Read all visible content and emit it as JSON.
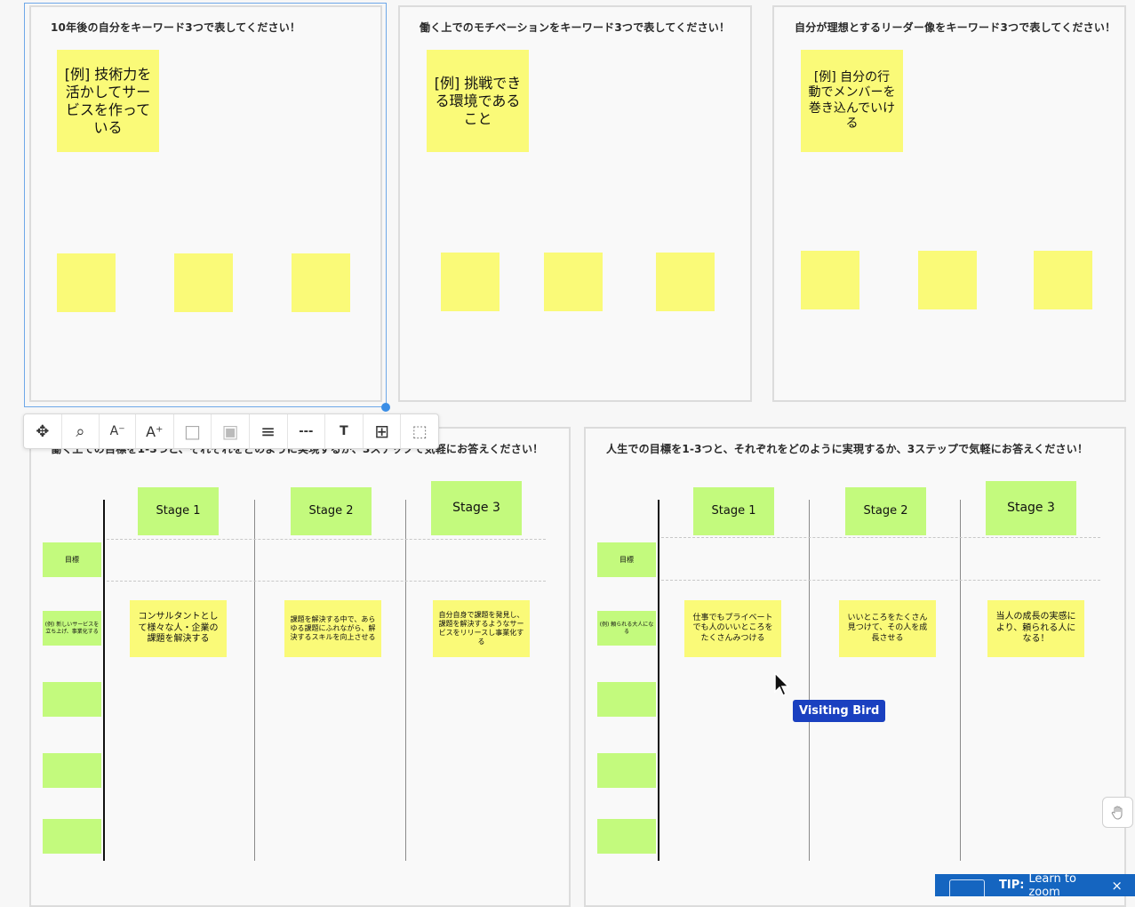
{
  "frames": {
    "f1": {
      "title": "10年後の自分をキーワード3つで表してください！",
      "example": "[例] 技術力を活かしてサービスを作っている"
    },
    "f2": {
      "title": "働く上でのモチベーションをキーワード3つで表してください！",
      "example": "[例] 挑戦できる環境であること"
    },
    "f3": {
      "title": "自分が理想とするリーダー像をキーワード3つで表してください！",
      "example": "[例] 自分の行動でメンバーを巻き込んでいける"
    },
    "f4": {
      "title": "働く上での目標を1-3つと、それぞれをどのように実現するか、3ステップで気軽にお答えください！",
      "stages": [
        "Stage 1",
        "Stage 2",
        "Stage 3"
      ],
      "goal_label": "目標",
      "example_label": "(例) 新しいサービスを立ち上げ、事業化する",
      "steps": [
        "コンサルタントとして様々な人・企業の課題を解決する",
        "課題を解決する中で、あらゆる課題にふれながら、解決するスキルを向上させる",
        "自分自身で課題を発見し、課題を解決するようなサービスをリリースし事業化する"
      ]
    },
    "f5": {
      "title": "人生での目標を1-3つと、それぞれをどのように実現するか、3ステップで気軽にお答えください！",
      "stages": [
        "Stage 1",
        "Stage 2",
        "Stage 3"
      ],
      "goal_label": "目標",
      "example_label": "(例) 頼られる大人になる",
      "steps": [
        "仕事でもプライベートでも人のいいところをたくさんみつける",
        "いいところをたくさん見つけて、その人を成長させる",
        "当人の成長の実感により、頼られる人になる！"
      ]
    }
  },
  "toolbar": {
    "items": [
      {
        "name": "move-icon",
        "glyph": "✥"
      },
      {
        "name": "zoom-to-fit-icon",
        "glyph": "⌕"
      },
      {
        "name": "decrease-font-icon",
        "glyph": "A⁻"
      },
      {
        "name": "increase-font-icon",
        "glyph": "A⁺"
      },
      {
        "name": "fill-color-icon",
        "glyph": "□"
      },
      {
        "name": "border-color-icon",
        "glyph": "▣"
      },
      {
        "name": "border-weight-icon",
        "glyph": "≡"
      },
      {
        "name": "border-style-icon",
        "glyph": "---"
      },
      {
        "name": "text-format-icon",
        "glyph": "T"
      },
      {
        "name": "grid-icon",
        "glyph": "⊞"
      },
      {
        "name": "add-to-selection-icon",
        "glyph": "⬚"
      }
    ]
  },
  "cursor": {
    "label": "Visiting Bird"
  },
  "tip": {
    "bold": "TIP:",
    "text": "Learn to zoom",
    "close": "×"
  },
  "colors": {
    "sticky_yellow": "#fafa78",
    "sticky_green": "#c3fa7d",
    "selection_blue": "#3a8ee6",
    "tip_blue": "#1565c0"
  }
}
